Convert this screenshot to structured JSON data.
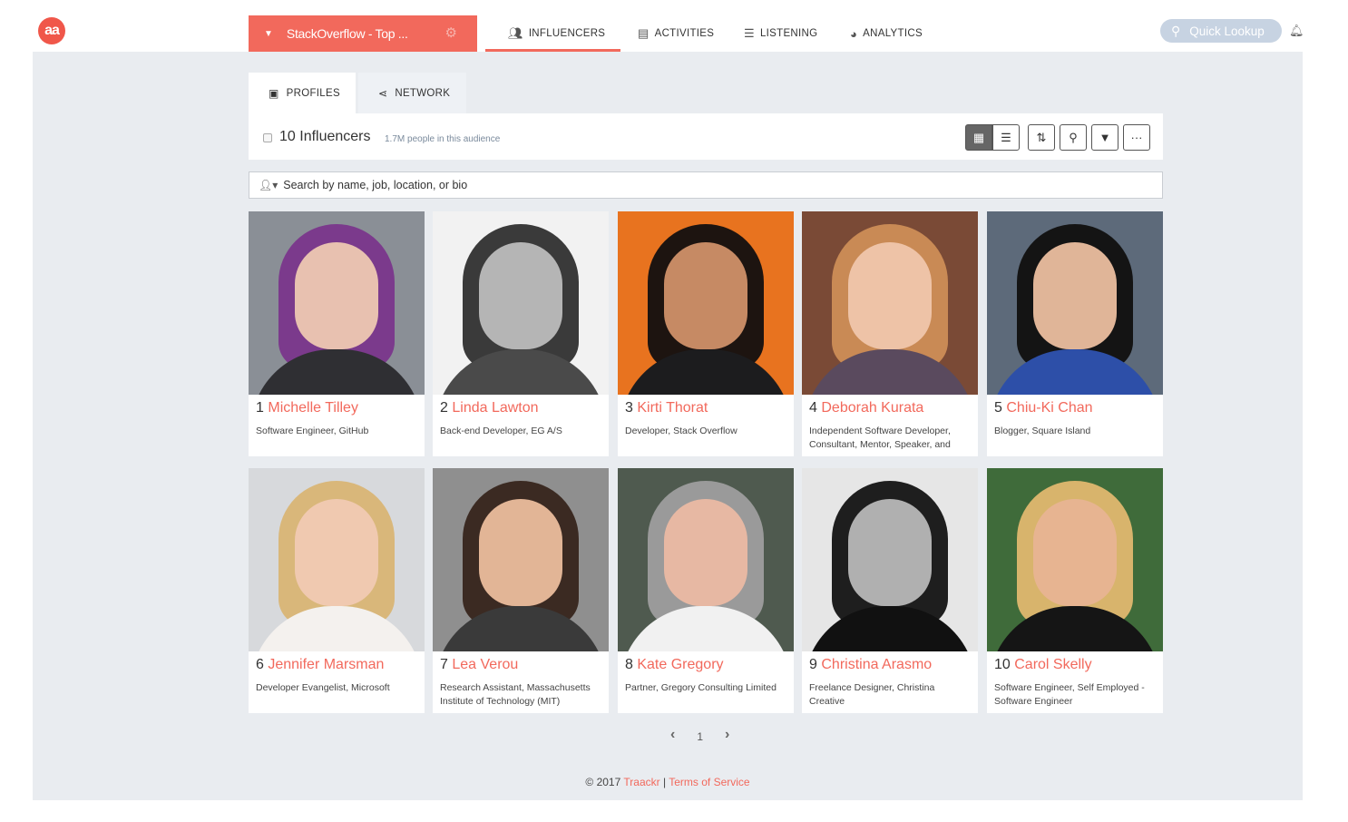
{
  "header": {
    "logo_text": "aa",
    "project_name": "StackOverflow - Top ...",
    "caret_icon": "caret-down-icon",
    "gear_icon": "gear-icon",
    "nav": [
      {
        "label": "INFLUENCERS",
        "icon": "users-icon",
        "active": true
      },
      {
        "label": "ACTIVITIES",
        "icon": "document-icon",
        "active": false
      },
      {
        "label": "LISTENING",
        "icon": "list-icon",
        "active": false
      },
      {
        "label": "ANALYTICS",
        "icon": "pie-icon",
        "active": false
      }
    ],
    "quick_lookup": "Quick Lookup",
    "accent": "#f2695c"
  },
  "subtabs": {
    "profiles": "PROFILES",
    "network": "NETWORK"
  },
  "toolbar": {
    "count": "10 Influencers",
    "audience": "1.7M people in this audience",
    "view_grid_icon": "grid-icon",
    "view_list_icon": "list-icon",
    "sort_icon": "sort-icon",
    "search_icon": "search-icon",
    "filter_icon": "filter-icon",
    "more_icon": "ellipsis-icon"
  },
  "search": {
    "placeholder": "Search by name, job, location, or bio"
  },
  "influencers": [
    {
      "rank": "1",
      "name": "Michelle Tilley",
      "role": "Software Engineer, GitHub"
    },
    {
      "rank": "2",
      "name": "Linda Lawton",
      "role": "Back-end Developer, EG A/S"
    },
    {
      "rank": "3",
      "name": "Kirti Thorat",
      "role": "Developer, Stack Overflow"
    },
    {
      "rank": "4",
      "name": "Deborah Kurata",
      "role": "Independent Software Developer, Consultant, Mentor, Speaker, and"
    },
    {
      "rank": "5",
      "name": "Chiu-Ki Chan",
      "role": "Blogger, Square Island"
    },
    {
      "rank": "6",
      "name": "Jennifer Marsman",
      "role": "Developer Evangelist, Microsoft"
    },
    {
      "rank": "7",
      "name": "Lea Verou",
      "role": "Research Assistant, Massachusetts Institute of Technology (MIT)"
    },
    {
      "rank": "8",
      "name": "Kate Gregory",
      "role": "Partner, Gregory Consulting Limited"
    },
    {
      "rank": "9",
      "name": "Christina Arasmo",
      "role": "Freelance Designer, Christina Creative"
    },
    {
      "rank": "10",
      "name": "Carol Skelly",
      "role": "Software Engineer, Self Employed - Software Engineer"
    }
  ],
  "pager": {
    "page": "1"
  },
  "footer": {
    "copyright": "© 2017",
    "brand": "Traackr",
    "sep": "|",
    "terms": "Terms of Service"
  }
}
